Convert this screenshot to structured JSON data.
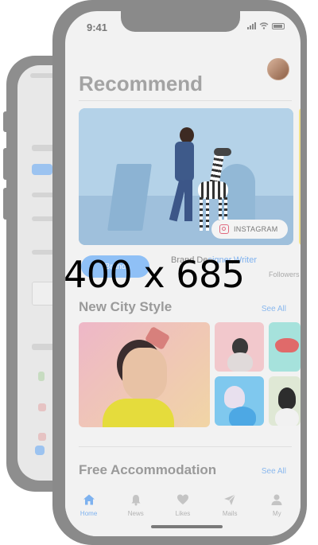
{
  "status_bar": {
    "time": "9:41"
  },
  "header": {
    "title": "Recommend"
  },
  "featured": {
    "instagram_label": "INSTAGRAM",
    "pill_label": "Brand",
    "byline_name": "Brand De",
    "byline_roles": "signer,Writer",
    "followers_label": "Followers"
  },
  "sections": {
    "new_city": {
      "title": "New City Style",
      "see_all": "See All"
    },
    "free_accommodation": {
      "title": "Free Accommodation",
      "see_all": "See All"
    }
  },
  "overlay": {
    "dimensions_text": "400 x 685"
  },
  "tabbar": {
    "items": [
      {
        "label": "Home",
        "icon": "home-icon",
        "active": true
      },
      {
        "label": "News",
        "icon": "bell-icon",
        "active": false
      },
      {
        "label": "Likes",
        "icon": "heart-icon",
        "active": false
      },
      {
        "label": "Mails",
        "icon": "paper-plane-icon",
        "active": false
      },
      {
        "label": "My",
        "icon": "person-icon",
        "active": false
      }
    ]
  },
  "colors": {
    "accent": "#7eb2ef",
    "hero_background": "#a7c8e3"
  }
}
